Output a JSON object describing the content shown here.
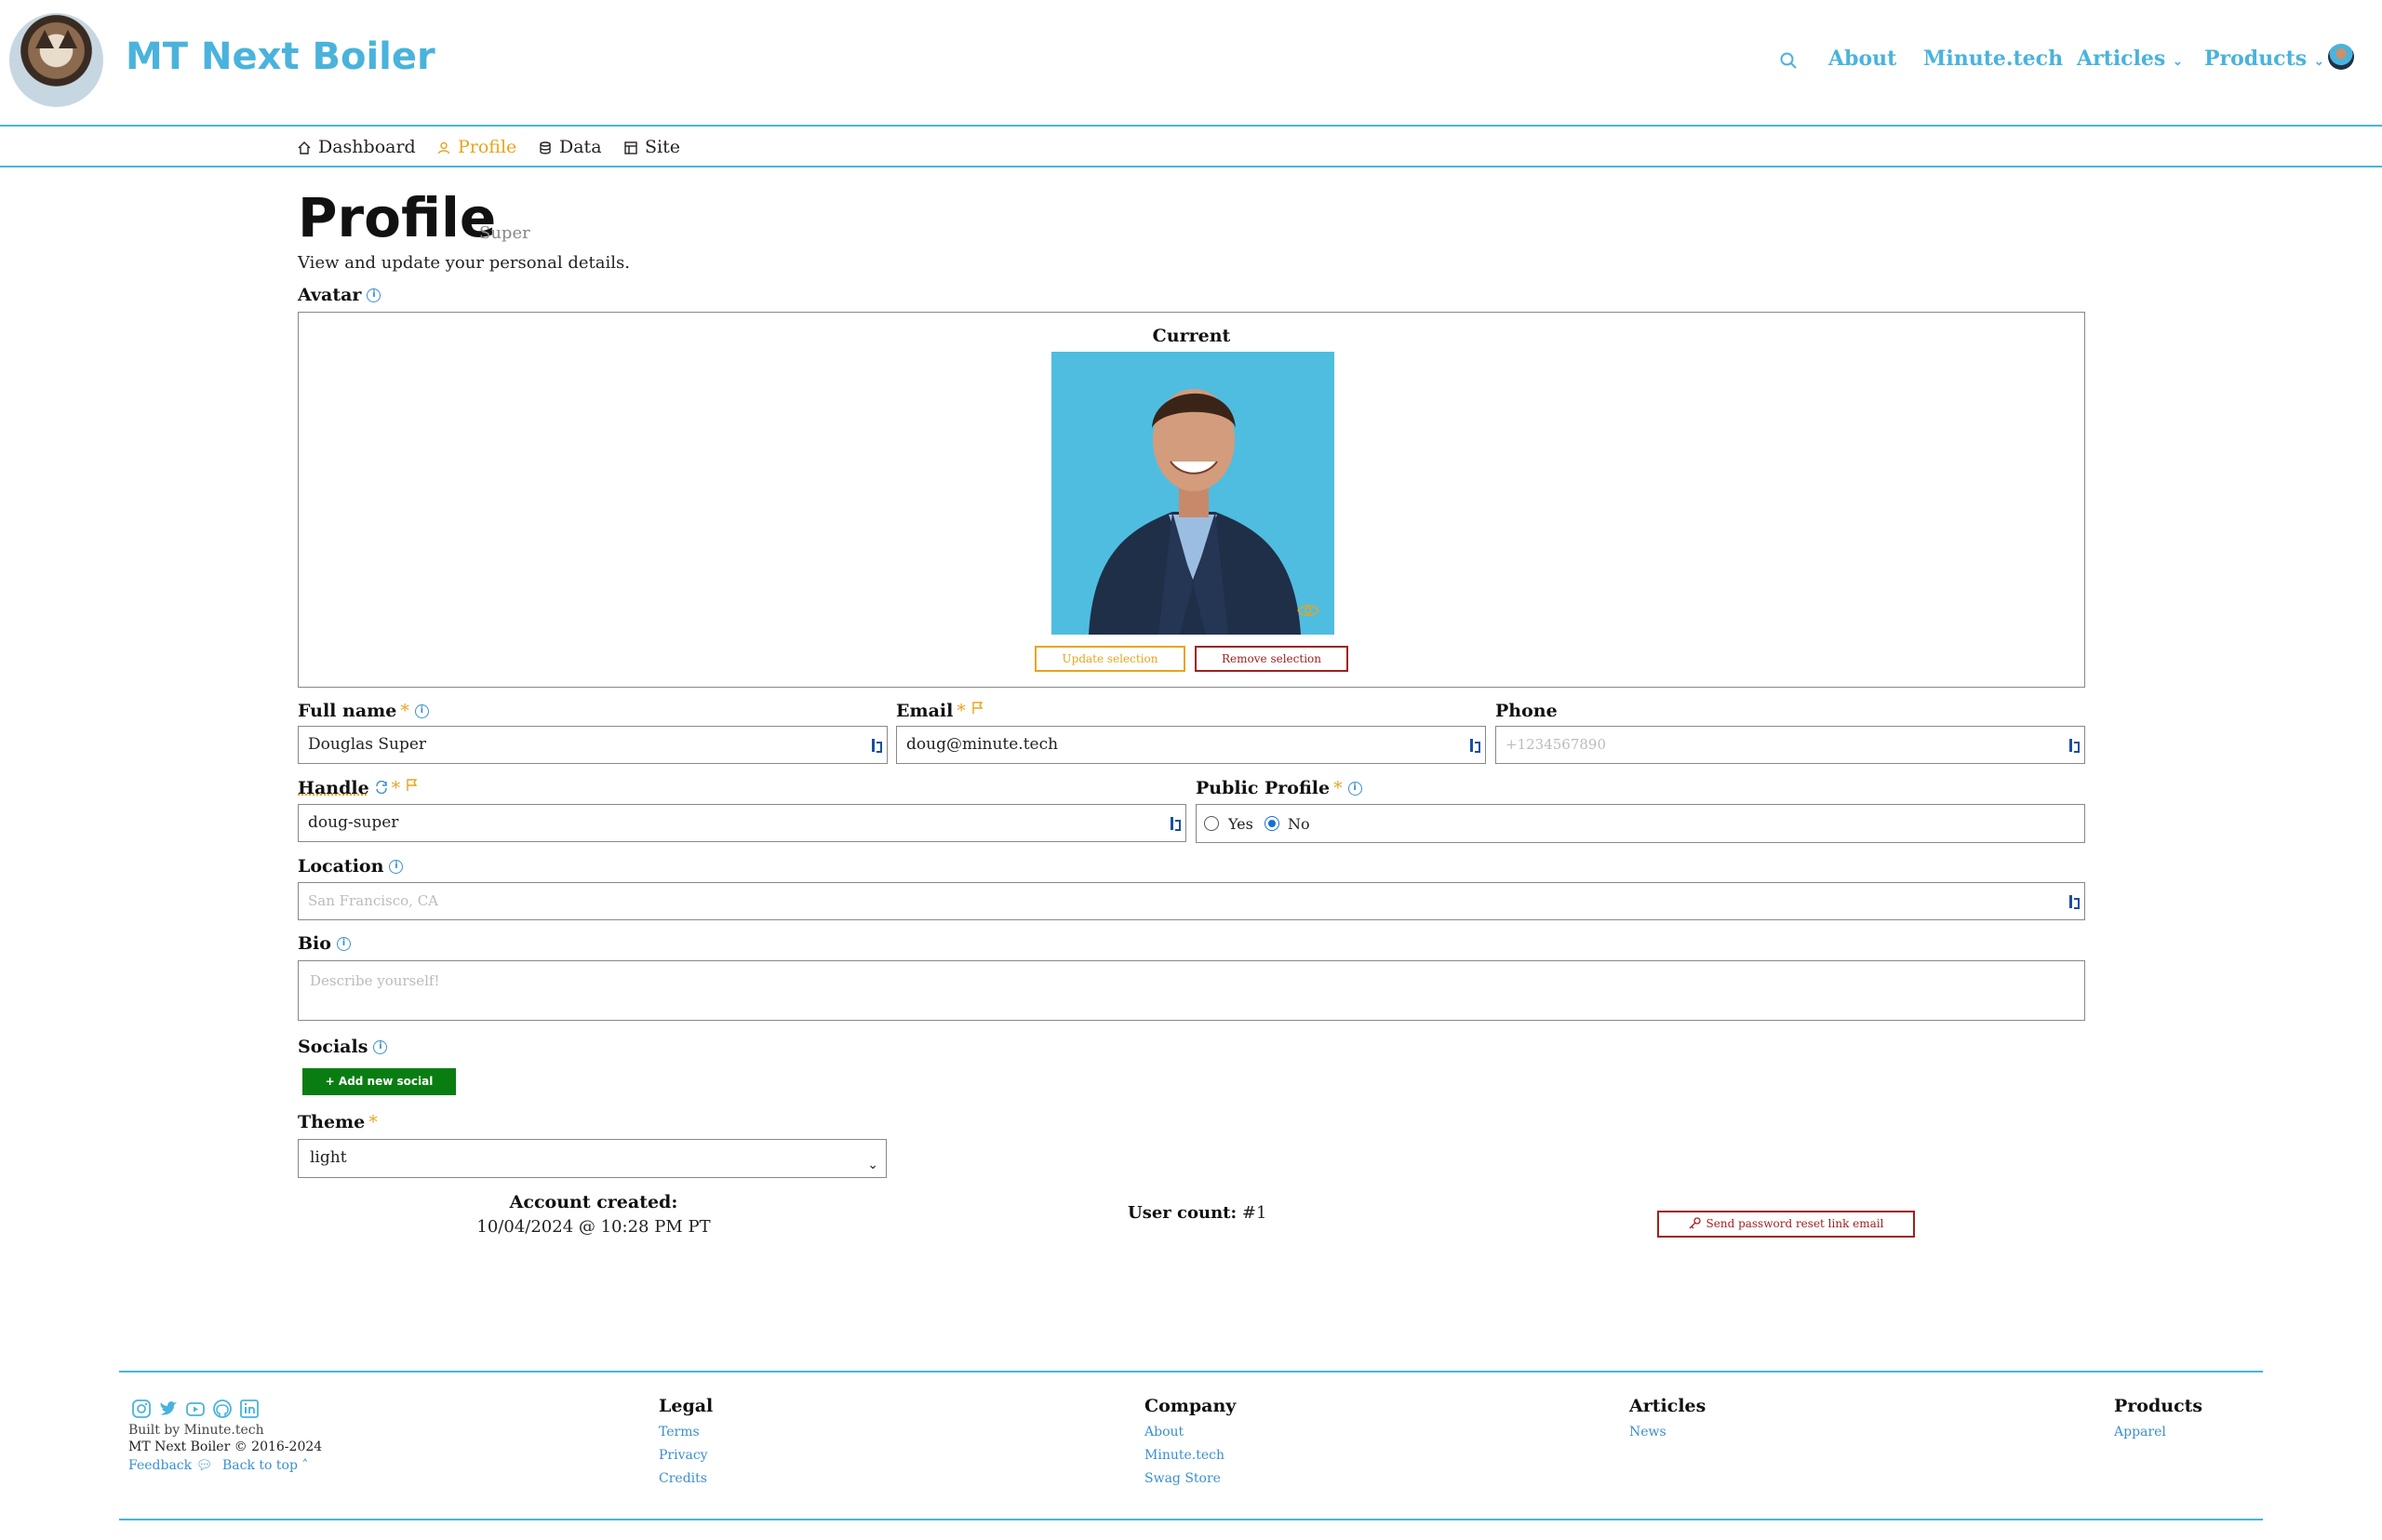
{
  "header": {
    "brand": "MT Next Boiler",
    "nav": [
      "About",
      "Minute.tech",
      "Articles",
      "Products"
    ]
  },
  "subnav": {
    "items": [
      "Dashboard",
      "Profile",
      "Data",
      "Site"
    ],
    "active": "Profile"
  },
  "page": {
    "title": "Profile",
    "role": "Super",
    "description": "View and update your personal details."
  },
  "avatar": {
    "label": "Avatar",
    "current_label": "Current",
    "update_label": "Update selection",
    "remove_label": "Remove selection"
  },
  "fields": {
    "full_name": {
      "label": "Full name",
      "value": "Douglas Super"
    },
    "email": {
      "label": "Email",
      "value": "doug@minute.tech"
    },
    "phone": {
      "label": "Phone",
      "placeholder": "+1234567890"
    },
    "handle": {
      "label": "Handle",
      "value": "doug-super"
    },
    "public_profile": {
      "label": "Public Profile",
      "options": [
        "Yes",
        "No"
      ],
      "selected": "No"
    },
    "location": {
      "label": "Location",
      "placeholder": "San Francisco, CA"
    },
    "bio": {
      "label": "Bio",
      "placeholder": "Describe yourself!"
    },
    "socials": {
      "label": "Socials",
      "add_label": "+ Add new social"
    },
    "theme": {
      "label": "Theme",
      "value": "light"
    }
  },
  "account": {
    "created_label": "Account created:",
    "created_value": "10/04/2024 @ 10:28 PM PT",
    "user_count_label": "User count:",
    "user_count_value": "#1",
    "reset_label": "Send password reset link email"
  },
  "footer": {
    "built_by": "Built by Minute.tech",
    "copyright": "MT Next Boiler © 2016-2024",
    "feedback": "Feedback",
    "back_to_top": "Back to top",
    "columns": [
      {
        "heading": "Legal",
        "links": [
          "Terms",
          "Privacy",
          "Credits"
        ]
      },
      {
        "heading": "Company",
        "links": [
          "About",
          "Minute.tech",
          "Swag Store"
        ]
      },
      {
        "heading": "Articles",
        "links": [
          "News"
        ]
      },
      {
        "heading": "Products",
        "links": [
          "Apparel"
        ]
      }
    ]
  },
  "colors": {
    "accent": "#4ab3dc",
    "warning": "#e8a41c",
    "danger": "#a02020",
    "success": "#0a7d12"
  }
}
